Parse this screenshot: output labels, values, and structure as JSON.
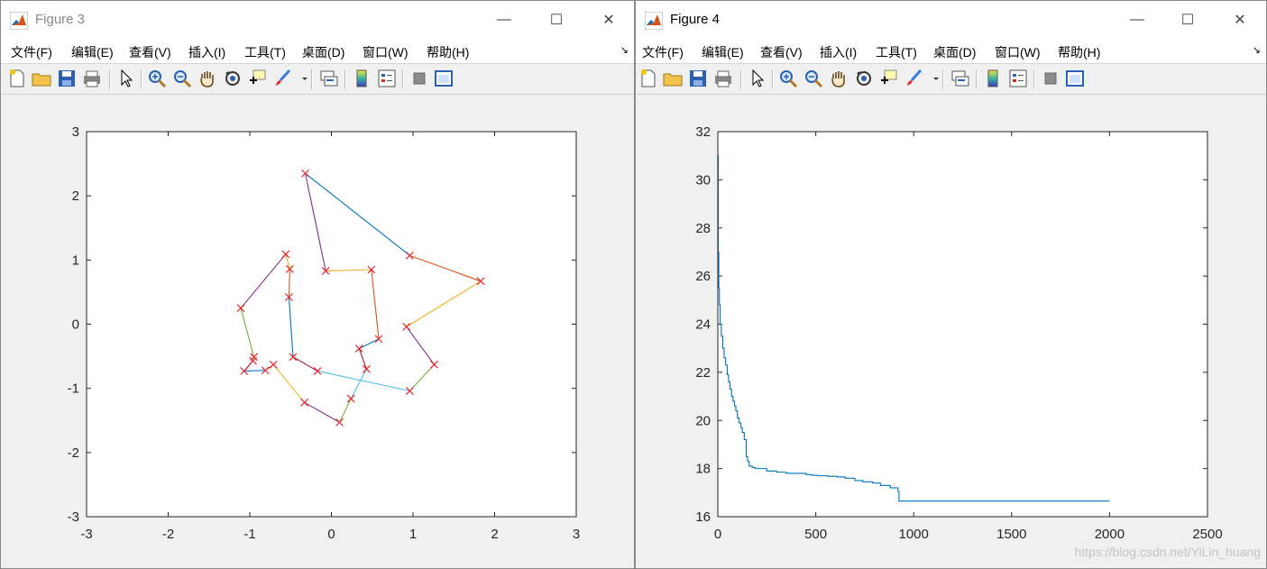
{
  "windows": [
    {
      "id": "fig3",
      "title": "Figure 3",
      "menus": [
        "文件(F)",
        "编辑(E)",
        "查看(V)",
        "插入(I)",
        "工具(T)",
        "桌面(D)",
        "窗口(W)",
        "帮助(H)"
      ],
      "chart_data": {
        "type": "line",
        "title": "",
        "xlabel": "",
        "ylabel": "",
        "xlim": [
          -3,
          3
        ],
        "ylim": [
          -3,
          3
        ],
        "xticks": [
          -3,
          -2,
          -1,
          0,
          1,
          2,
          3
        ],
        "yticks": [
          -3,
          -2,
          -1,
          0,
          1,
          2,
          3
        ],
        "tick_labels_x": [
          "-3",
          "-2",
          "-1",
          "0",
          "1",
          "2",
          "3"
        ],
        "tick_labels_y": [
          "-3",
          "-2",
          "-1",
          "0",
          "1",
          "2",
          "3"
        ],
        "marker": "x",
        "marker_color": "#e6262d",
        "segment_colors": [
          "#0072bd",
          "#d95319",
          "#edb120",
          "#7e2f8e",
          "#77ac30",
          "#4dbeee",
          "#a2142f"
        ],
        "points": [
          [
            -0.32,
            2.35
          ],
          [
            0.96,
            1.07
          ],
          [
            1.83,
            0.67
          ],
          [
            0.92,
            -0.04
          ],
          [
            1.26,
            -0.63
          ],
          [
            0.96,
            -1.04
          ],
          [
            -0.17,
            -0.73
          ],
          [
            -0.47,
            -0.51
          ],
          [
            -0.52,
            0.42
          ],
          [
            -0.51,
            0.86
          ],
          [
            -0.56,
            1.09
          ],
          [
            -1.11,
            0.25
          ],
          [
            -0.95,
            -0.51
          ],
          [
            -0.96,
            -0.57
          ],
          [
            -1.07,
            -0.73
          ],
          [
            -0.81,
            -0.72
          ],
          [
            -0.71,
            -0.63
          ],
          [
            -0.33,
            -1.22
          ],
          [
            0.1,
            -1.53
          ],
          [
            0.24,
            -1.16
          ],
          [
            0.43,
            -0.7
          ],
          [
            0.34,
            -0.38
          ],
          [
            0.58,
            -0.23
          ],
          [
            0.49,
            0.85
          ],
          [
            -0.07,
            0.83
          ],
          [
            -0.32,
            2.35
          ]
        ]
      }
    },
    {
      "id": "fig4",
      "title": "Figure 4",
      "menus": [
        "文件(F)",
        "编辑(E)",
        "查看(V)",
        "插入(I)",
        "工具(T)",
        "桌面(D)",
        "窗口(W)",
        "帮助(H)"
      ],
      "chart_data": {
        "type": "line",
        "title": "",
        "xlabel": "",
        "ylabel": "",
        "xlim": [
          0,
          2500
        ],
        "ylim": [
          16,
          32
        ],
        "xticks": [
          0,
          500,
          1000,
          1500,
          2000,
          2500
        ],
        "yticks": [
          16,
          18,
          20,
          22,
          24,
          26,
          28,
          30,
          32
        ],
        "tick_labels_x": [
          "0",
          "500",
          "1000",
          "1500",
          "2000",
          "2500"
        ],
        "tick_labels_y": [
          "16",
          "18",
          "20",
          "22",
          "24",
          "26",
          "28",
          "30",
          "32"
        ],
        "line_color": "#0072bd",
        "series": [
          {
            "x": [
              0,
              2,
              5,
              8,
              12,
              18,
              25,
              32,
              40,
              48,
              55,
              62,
              70,
              78,
              85,
              92,
              100,
              108,
              118,
              125,
              135,
              145,
              152,
              160,
              175,
              190,
              210,
              250,
              300,
              350,
              380,
              420,
              450,
              480,
              510,
              560,
              610,
              650,
              700,
              740,
              790,
              830,
              880,
              920,
              925,
              1000,
              1500,
              2000
            ],
            "y": [
              31.0,
              27.0,
              25.5,
              24.8,
              24.0,
              23.5,
              23.0,
              22.6,
              22.3,
              21.9,
              21.6,
              21.3,
              21.0,
              20.8,
              20.6,
              20.4,
              20.1,
              19.9,
              19.7,
              19.5,
              19.2,
              18.5,
              18.3,
              18.1,
              18.05,
              18.0,
              18.0,
              17.9,
              17.85,
              17.8,
              17.8,
              17.8,
              17.75,
              17.72,
              17.7,
              17.68,
              17.65,
              17.6,
              17.5,
              17.45,
              17.4,
              17.3,
              17.2,
              17.05,
              16.65,
              16.65,
              16.65,
              16.65
            ]
          }
        ]
      },
      "watermark": "https://blog.csdn.net/YiLin_huang"
    }
  ]
}
